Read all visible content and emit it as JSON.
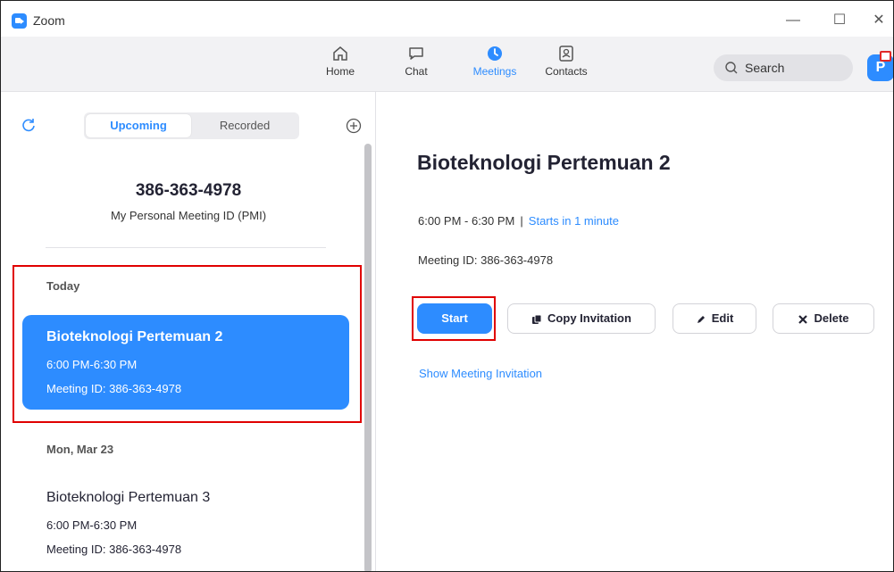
{
  "window": {
    "title": "Zoom"
  },
  "nav": {
    "tabs": [
      {
        "label": "Home",
        "icon": "home-icon"
      },
      {
        "label": "Chat",
        "icon": "chat-icon"
      },
      {
        "label": "Meetings",
        "icon": "clock-icon",
        "active": true
      },
      {
        "label": "Contacts",
        "icon": "contacts-icon"
      }
    ],
    "search_label": "Search",
    "avatar_initial": "P"
  },
  "left": {
    "tabs": {
      "upcoming": "Upcoming",
      "recorded": "Recorded"
    },
    "pmi": {
      "number": "386-363-4978",
      "label": "My Personal Meeting ID (PMI)"
    },
    "groups": [
      {
        "day": "Today",
        "meeting": {
          "title": "Bioteknologi Pertemuan 2",
          "time": "6:00 PM-6:30 PM",
          "id": "Meeting ID: 386-363-4978"
        }
      },
      {
        "day": "Mon, Mar 23",
        "meeting": {
          "title": "Bioteknologi Pertemuan 3",
          "time": "6:00 PM-6:30 PM",
          "id": "Meeting ID: 386-363-4978"
        }
      }
    ]
  },
  "detail": {
    "title": "Bioteknologi Pertemuan 2",
    "time": "6:00 PM - 6:30 PM",
    "separator": "|",
    "starts": "Starts in 1 minute",
    "meeting_id": "Meeting ID: 386-363-4978",
    "buttons": {
      "start": "Start",
      "copy": "Copy Invitation",
      "edit": "Edit",
      "delete": "Delete"
    },
    "show_invitation": "Show Meeting Invitation"
  },
  "colors": {
    "accent": "#2d8cff",
    "highlight": "#e00000"
  }
}
